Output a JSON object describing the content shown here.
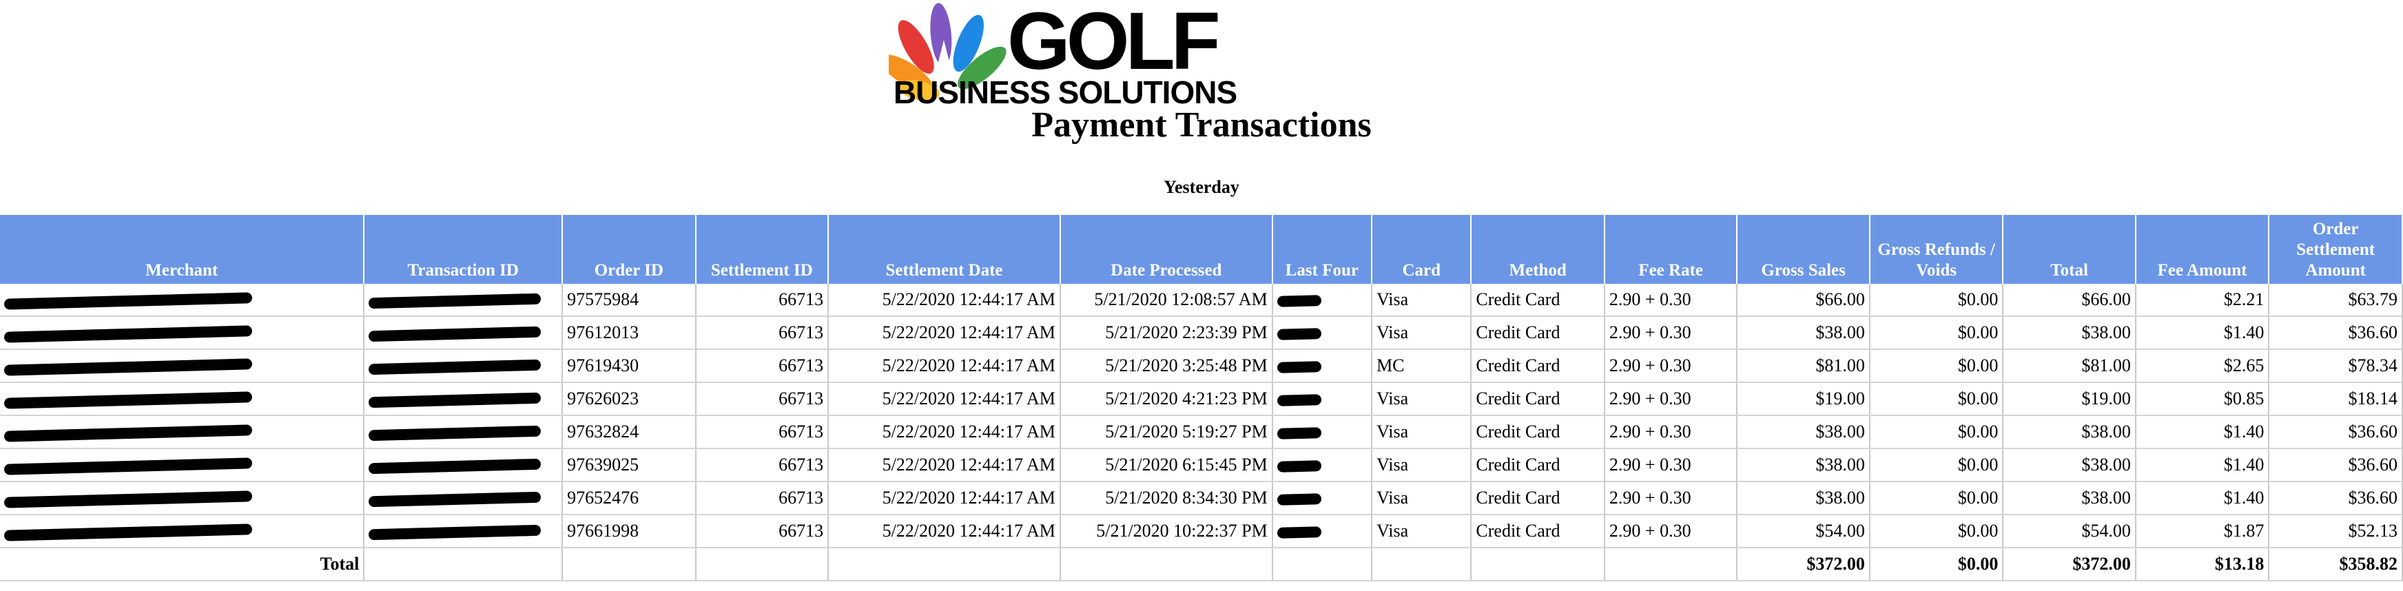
{
  "logo": {
    "name": "nbc-golf-peacock-logo",
    "word": "GOLF",
    "tagline": "BUSINESS SOLUTIONS",
    "colors": [
      "#e53935",
      "#f7921e",
      "#fbc02d",
      "#43a047",
      "#1e88e5",
      "#7e57c2"
    ]
  },
  "title": "Payment Transactions",
  "subtitle": "Yesterday",
  "table": {
    "header_color": "#6b96e6",
    "columns": [
      {
        "key": "merchant",
        "label": "Merchant"
      },
      {
        "key": "transaction_id",
        "label": "Transaction ID"
      },
      {
        "key": "order_id",
        "label": "Order ID"
      },
      {
        "key": "settlement_id",
        "label": "Settlement ID"
      },
      {
        "key": "settlement_date",
        "label": "Settlement Date"
      },
      {
        "key": "date_processed",
        "label": "Date Processed"
      },
      {
        "key": "last_four",
        "label": "Last Four"
      },
      {
        "key": "card",
        "label": "Card"
      },
      {
        "key": "method",
        "label": "Method"
      },
      {
        "key": "fee_rate",
        "label": "Fee Rate"
      },
      {
        "key": "gross_sales",
        "label": "Gross Sales"
      },
      {
        "key": "gross_refunds",
        "label": "Gross Refunds / Voids"
      },
      {
        "key": "total",
        "label": "Total"
      },
      {
        "key": "fee_amount",
        "label": "Fee Amount"
      },
      {
        "key": "order_settlement",
        "label": "Order Settlement Amount"
      }
    ],
    "rows": [
      {
        "merchant": "[redacted]",
        "transaction_id": "[redacted]",
        "order_id": "97575984",
        "settlement_id": "66713",
        "settlement_date": "5/22/2020 12:44:17 AM",
        "date_processed": "5/21/2020 12:08:57 AM",
        "last_four": "[redacted]",
        "card": "Visa",
        "method": "Credit Card",
        "fee_rate": "2.90 + 0.30",
        "gross_sales": "$66.00",
        "gross_refunds": "$0.00",
        "total": "$66.00",
        "fee_amount": "$2.21",
        "order_settlement": "$63.79"
      },
      {
        "merchant": "[redacted]",
        "transaction_id": "[redacted]",
        "order_id": "97612013",
        "settlement_id": "66713",
        "settlement_date": "5/22/2020 12:44:17 AM",
        "date_processed": "5/21/2020 2:23:39 PM",
        "last_four": "[redacted]",
        "card": "Visa",
        "method": "Credit Card",
        "fee_rate": "2.90 + 0.30",
        "gross_sales": "$38.00",
        "gross_refunds": "$0.00",
        "total": "$38.00",
        "fee_amount": "$1.40",
        "order_settlement": "$36.60"
      },
      {
        "merchant": "[redacted]",
        "transaction_id": "[redacted]",
        "order_id": "97619430",
        "settlement_id": "66713",
        "settlement_date": "5/22/2020 12:44:17 AM",
        "date_processed": "5/21/2020 3:25:48 PM",
        "last_four": "[redacted]",
        "card": "MC",
        "method": "Credit Card",
        "fee_rate": "2.90 + 0.30",
        "gross_sales": "$81.00",
        "gross_refunds": "$0.00",
        "total": "$81.00",
        "fee_amount": "$2.65",
        "order_settlement": "$78.34"
      },
      {
        "merchant": "[redacted]",
        "transaction_id": "[redacted]",
        "order_id": "97626023",
        "settlement_id": "66713",
        "settlement_date": "5/22/2020 12:44:17 AM",
        "date_processed": "5/21/2020 4:21:23 PM",
        "last_four": "[redacted]",
        "card": "Visa",
        "method": "Credit Card",
        "fee_rate": "2.90 + 0.30",
        "gross_sales": "$19.00",
        "gross_refunds": "$0.00",
        "total": "$19.00",
        "fee_amount": "$0.85",
        "order_settlement": "$18.14"
      },
      {
        "merchant": "[redacted]",
        "transaction_id": "[redacted]",
        "order_id": "97632824",
        "settlement_id": "66713",
        "settlement_date": "5/22/2020 12:44:17 AM",
        "date_processed": "5/21/2020 5:19:27 PM",
        "last_four": "[redacted]",
        "card": "Visa",
        "method": "Credit Card",
        "fee_rate": "2.90 + 0.30",
        "gross_sales": "$38.00",
        "gross_refunds": "$0.00",
        "total": "$38.00",
        "fee_amount": "$1.40",
        "order_settlement": "$36.60"
      },
      {
        "merchant": "[redacted]",
        "transaction_id": "[redacted]",
        "order_id": "97639025",
        "settlement_id": "66713",
        "settlement_date": "5/22/2020 12:44:17 AM",
        "date_processed": "5/21/2020 6:15:45 PM",
        "last_four": "[redacted]",
        "card": "Visa",
        "method": "Credit Card",
        "fee_rate": "2.90 + 0.30",
        "gross_sales": "$38.00",
        "gross_refunds": "$0.00",
        "total": "$38.00",
        "fee_amount": "$1.40",
        "order_settlement": "$36.60"
      },
      {
        "merchant": "[redacted]",
        "transaction_id": "[redacted]",
        "order_id": "97652476",
        "settlement_id": "66713",
        "settlement_date": "5/22/2020 12:44:17 AM",
        "date_processed": "5/21/2020 8:34:30 PM",
        "last_four": "[redacted]",
        "card": "Visa",
        "method": "Credit Card",
        "fee_rate": "2.90 + 0.30",
        "gross_sales": "$38.00",
        "gross_refunds": "$0.00",
        "total": "$38.00",
        "fee_amount": "$1.40",
        "order_settlement": "$36.60"
      },
      {
        "merchant": "[redacted]",
        "transaction_id": "[redacted]",
        "order_id": "97661998",
        "settlement_id": "66713",
        "settlement_date": "5/22/2020 12:44:17 AM",
        "date_processed": "5/21/2020 10:22:37 PM",
        "last_four": "[redacted]",
        "card": "Visa",
        "method": "Credit Card",
        "fee_rate": "2.90 + 0.30",
        "gross_sales": "$54.00",
        "gross_refunds": "$0.00",
        "total": "$54.00",
        "fee_amount": "$1.87",
        "order_settlement": "$52.13"
      }
    ],
    "totals": {
      "label": "Total",
      "gross_sales": "$372.00",
      "gross_refunds": "$0.00",
      "total": "$372.00",
      "fee_amount": "$13.18",
      "order_settlement": "$358.82"
    }
  }
}
